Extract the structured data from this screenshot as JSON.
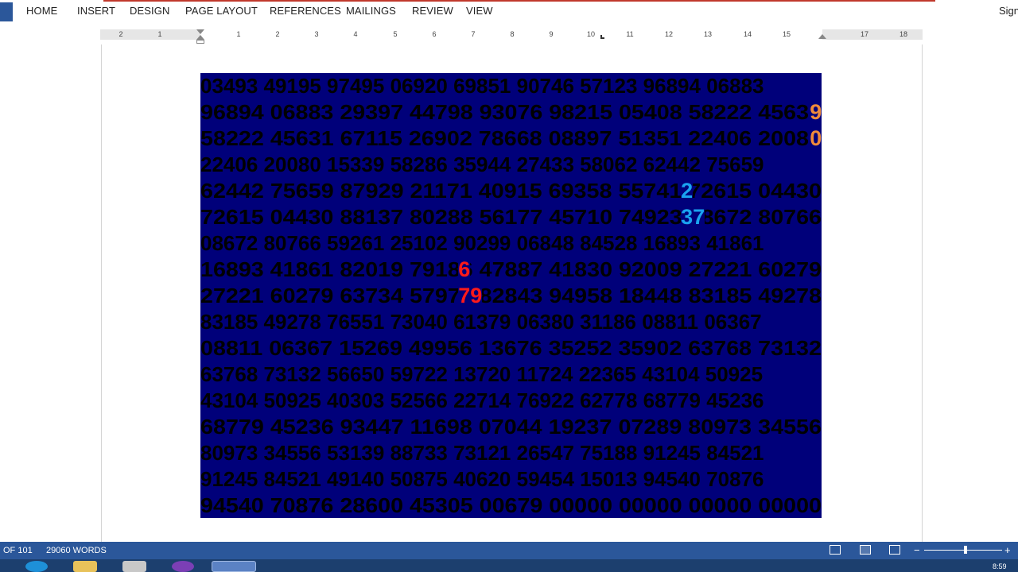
{
  "ribbon": {
    "tabs": [
      "HOME",
      "INSERT",
      "DESIGN",
      "PAGE LAYOUT",
      "REFERENCES",
      "MAILINGS",
      "REVIEW",
      "VIEW"
    ],
    "sign_in": "Sign"
  },
  "ruler": {
    "left_labels": [
      "2",
      "1"
    ],
    "right_labels": [
      "1",
      "2",
      "3",
      "4",
      "5",
      "6",
      "7",
      "8",
      "9",
      "10",
      "11",
      "12",
      "13",
      "14",
      "15",
      "17",
      "18"
    ]
  },
  "document": {
    "number_rows": [
      "03493 49195 97495 06920 69851 90746 57123 96894 06883",
      "96894 06883 29397 44798 93076 98215 05408 58222 45631",
      "58222 45631 67115 26902 78668 08897 51351 22406 20080",
      "22406 20080 15339 58286 35944 27433 58062 62442 75659",
      "62442 75659 87929 21171 40915 69358 55741 72615 04430",
      "72615 04430 88137 80288 56177 45710 74923 08672 80766",
      "08672 80766 59261 25102 90299 06848 84528 16893 41861",
      "16893 41861 82019 79186 47887 41830 92009 27221 60279",
      "27221 60279 63734 57973 82843 94958 18448 83185 49278",
      "83185 49278 76551 73040 61379 06380 31186 08811 06367",
      "08811 06367 15269 49956 13676 35252 35902 63768 73132",
      "63768 73132 56650 59722 13720 11724 22365 43104 50925",
      "43104 50925 40303 52566 22714 76922 62778 68779 45236",
      "68779 45236 93447 11698 07044 19237 07289 80973 34556",
      "80973 34556 53139 88733 73121 26547 75188 91245 84521",
      "91245 84521 49140 50875 40620 59454 15013 94540 70876",
      "94540 70876 28600 45305 00679 00000 00000 00000 00000"
    ],
    "highlights": [
      {
        "row": 1,
        "col": 52,
        "text": "9",
        "color": "#f08a3a"
      },
      {
        "row": 2,
        "col": 52,
        "text": "02",
        "color": "#f08a3a"
      },
      {
        "row": 4,
        "col": 41,
        "text": "2",
        "color": "#1aa3f0"
      },
      {
        "row": 5,
        "col": 41,
        "text": "37",
        "color": "#1aa3f0"
      },
      {
        "row": 7,
        "col": 22,
        "text": "6",
        "color": "#ff1a1a"
      },
      {
        "row": 8,
        "col": 22,
        "text": "79",
        "color": "#ff1a1a"
      },
      {
        "row": 10,
        "col": 89,
        "text": "902",
        "color": "#f08a3a"
      },
      {
        "row": 13,
        "col": 72,
        "text": "237",
        "color": "#1aa3f0"
      },
      {
        "row": 16,
        "col": 59,
        "text": "679",
        "color": "#ff1a1a"
      }
    ],
    "background_color": "#00007a"
  },
  "status_bar": {
    "page": "OF 101",
    "words": "29060 WORDS",
    "zoom_minus": "−",
    "zoom_plus": "+"
  },
  "taskbar": {
    "clock": "8:59"
  }
}
